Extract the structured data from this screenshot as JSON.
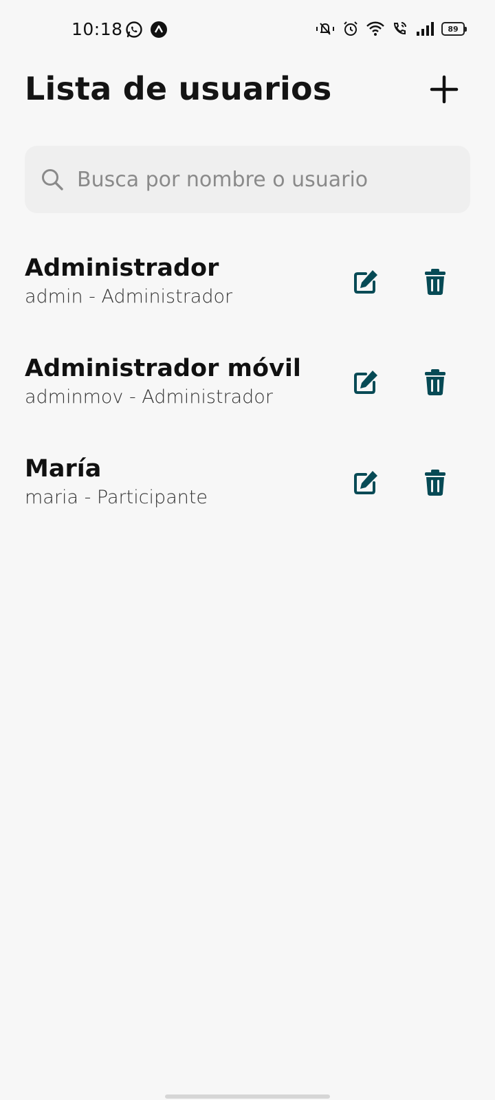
{
  "status_bar": {
    "time": "10:18",
    "battery": "89",
    "left_icons": [
      "whatsapp-icon",
      "app-notification-icon"
    ],
    "right_icons": [
      "mute-vibrate-icon",
      "alarm-icon",
      "wifi-icon",
      "wifi-calling-icon",
      "signal-icon",
      "battery-icon"
    ]
  },
  "header": {
    "title": "Lista de usuarios",
    "add_icon": "plus-icon"
  },
  "search": {
    "placeholder": "Busca por nombre o usuario",
    "value": "",
    "icon": "search-icon"
  },
  "users": [
    {
      "name": "Administrador",
      "subtitle": "admin - Administrador"
    },
    {
      "name": "Administrador móvil",
      "subtitle": "adminmov - Administrador"
    },
    {
      "name": "María",
      "subtitle": "maria - Participante"
    }
  ],
  "colors": {
    "accent": "#074a55",
    "background": "#f7f7f7",
    "search_bg": "#efefef"
  }
}
